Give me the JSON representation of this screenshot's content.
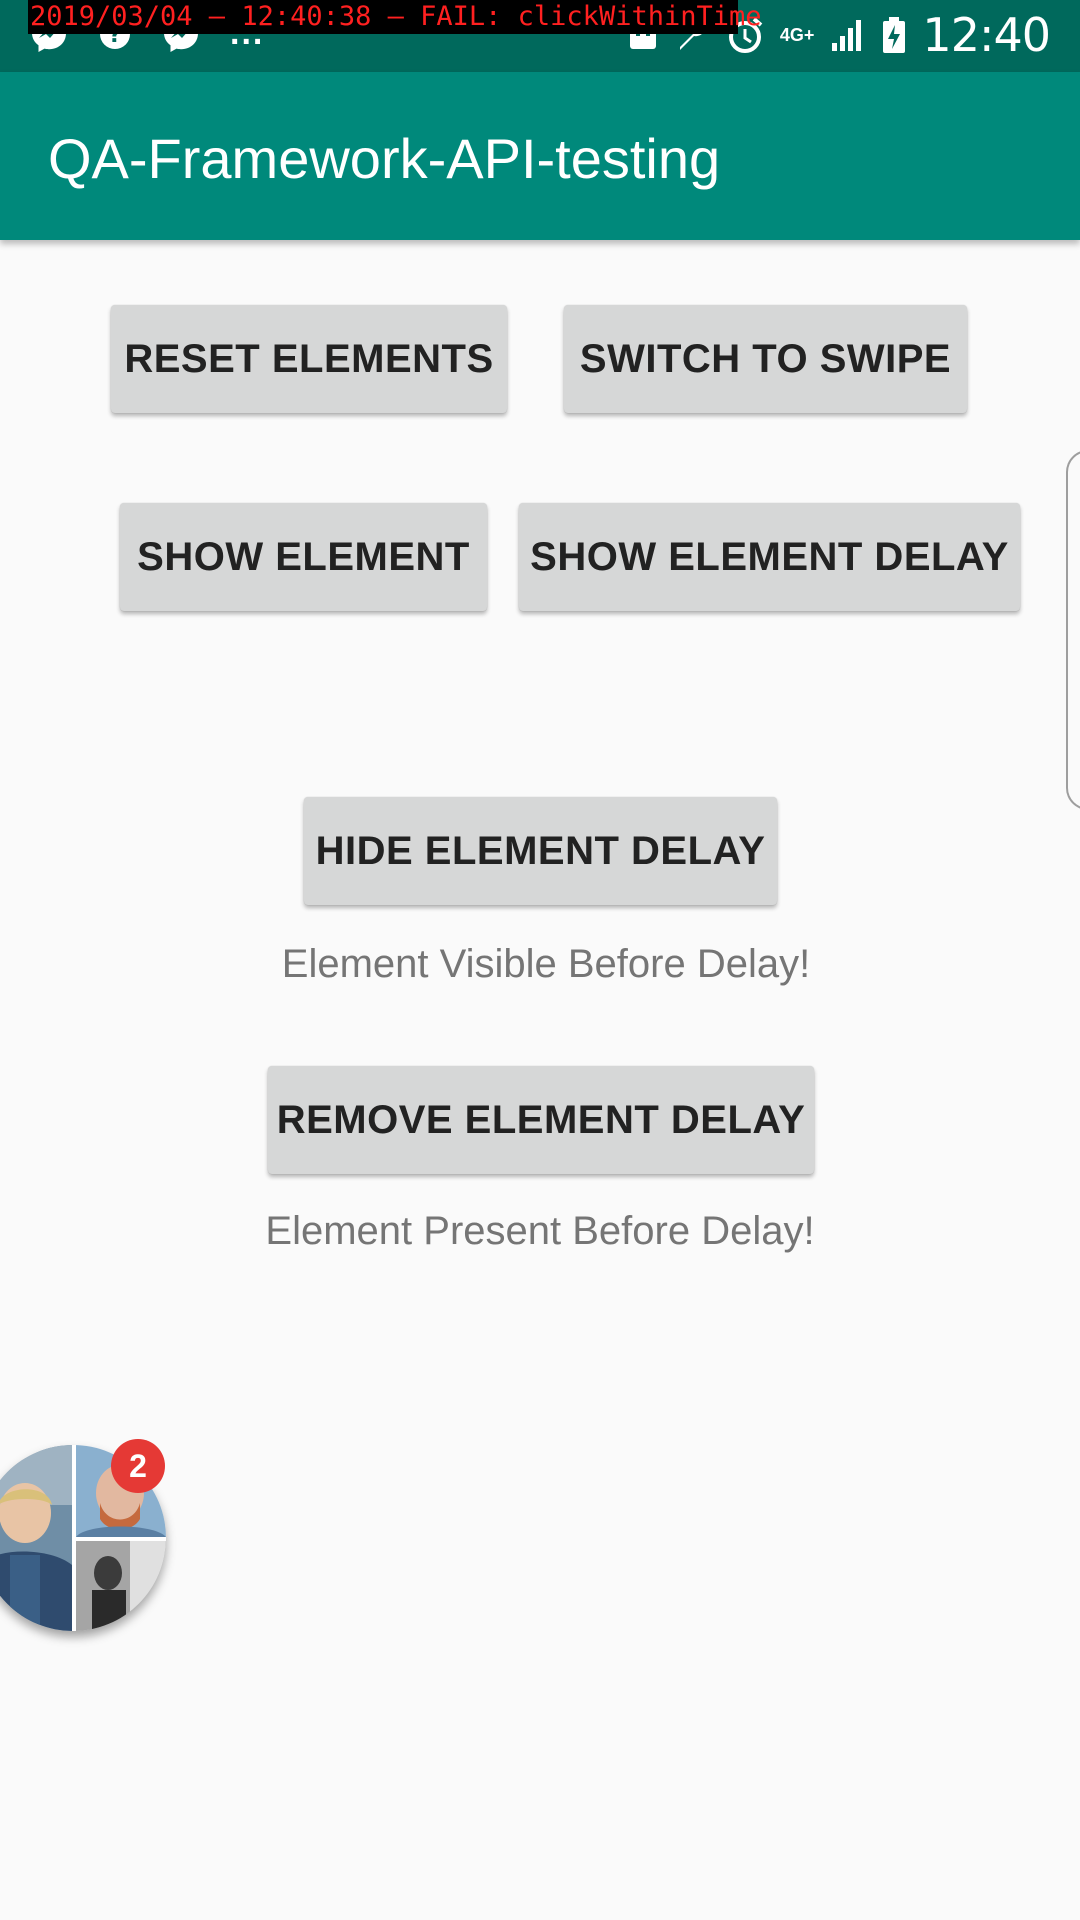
{
  "status_bar": {
    "time": "12:40",
    "network": "4G+",
    "overflow": "...",
    "icons": [
      "messenger-icon",
      "help-chat-icon",
      "messenger-icon",
      "app-notification-icon",
      "wrench-icon",
      "alarm-icon",
      "network-4g-icon",
      "signal-icon",
      "battery-charging-icon"
    ]
  },
  "log_overlay": "2019/03/04 – 12:40:38 – FAIL: clickWithinTime",
  "app_bar": {
    "title": "QA-Framework-API-testing"
  },
  "buttons": {
    "reset": "RESET ELEMENTS",
    "swipe": "SWITCH TO SWIPE",
    "show": "SHOW ELEMENT",
    "show_delay": "SHOW ELEMENT DELAY",
    "hide_delay": "HIDE ELEMENT DELAY",
    "remove_delay": "REMOVE ELEMENT DELAY"
  },
  "texts": {
    "visible": "Element Visible Before Delay!",
    "present": "Element Present Before Delay!"
  },
  "chat_head": {
    "badge_count": "2"
  },
  "colors": {
    "status_bar": "#00695c",
    "app_bar": "#00897b",
    "button": "#d6d7d7",
    "badge": "#e53935"
  }
}
